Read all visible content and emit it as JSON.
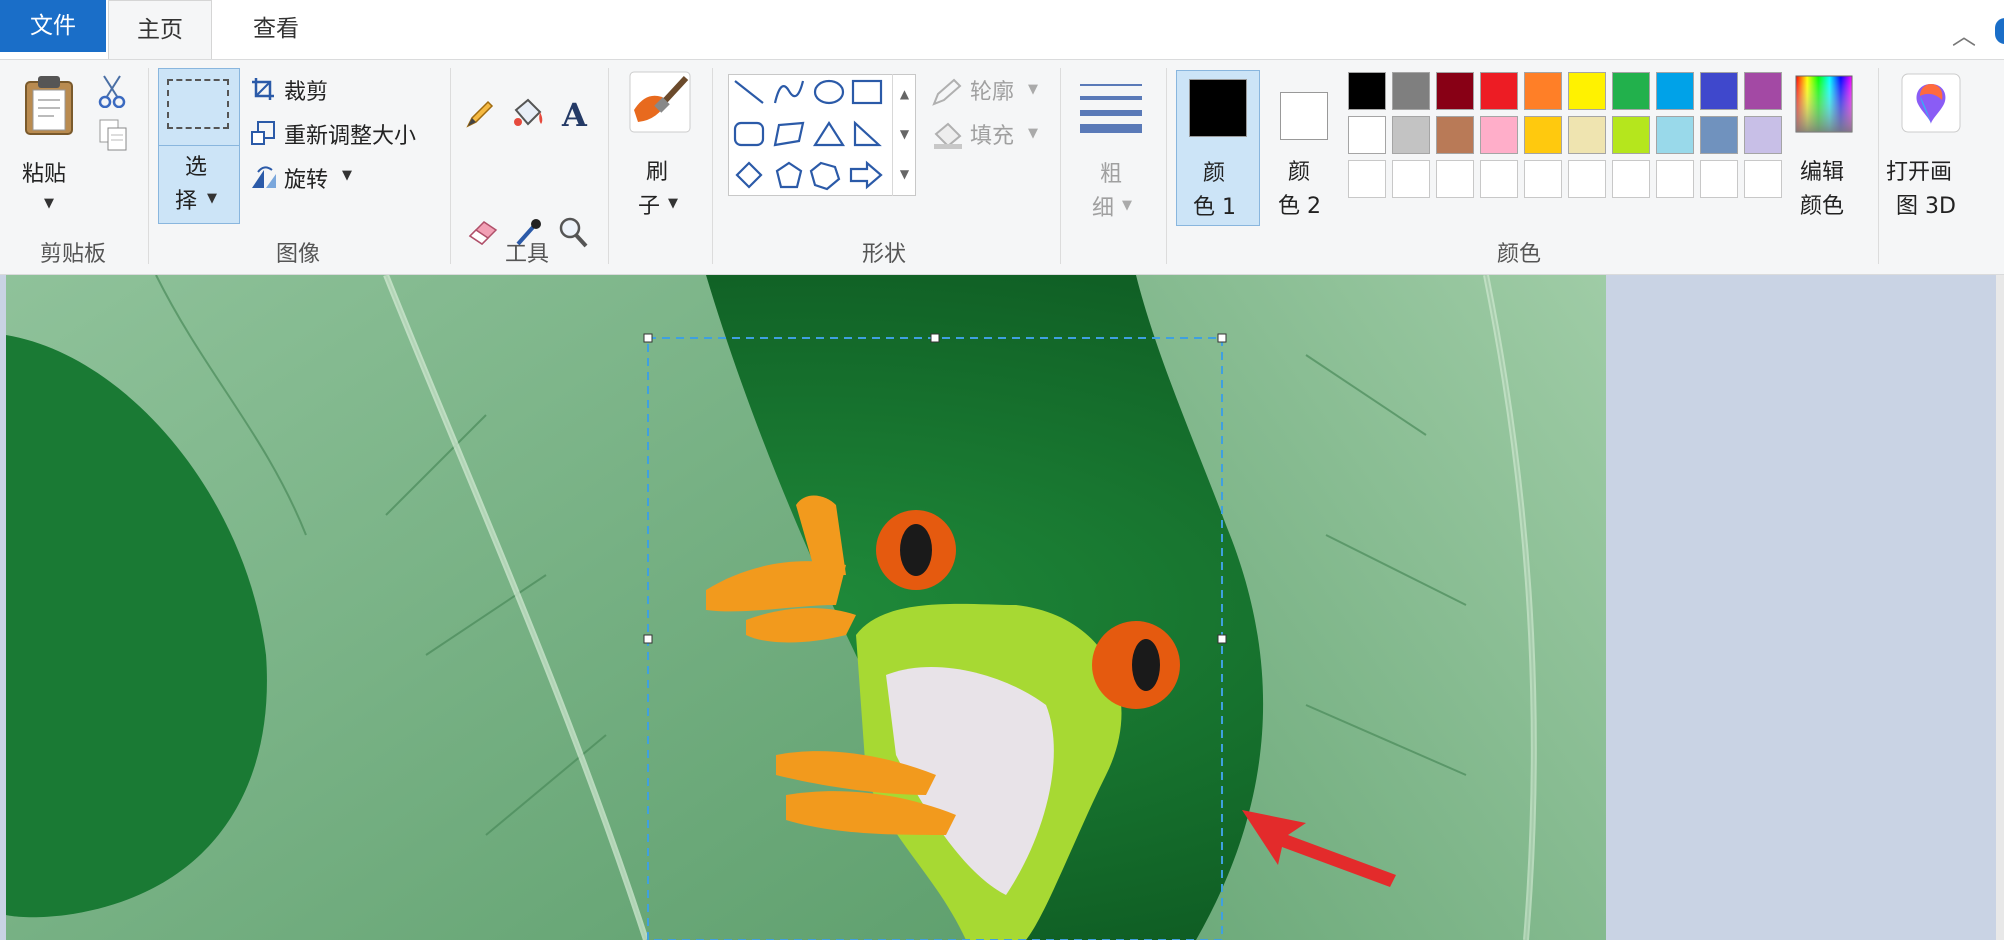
{
  "tabs": [
    {
      "label": "文件"
    },
    {
      "label": "主页"
    },
    {
      "label": "查看"
    }
  ],
  "groups": {
    "clipboard": {
      "label": "剪贴板",
      "paste": "粘贴"
    },
    "image": {
      "label": "图像",
      "select_line1": "选",
      "select_line2": "择",
      "crop": "裁剪",
      "resize": "重新调整大小",
      "rotate": "旋转"
    },
    "tools": {
      "label": "工具"
    },
    "brushes": {
      "line1": "刷",
      "line2": "子"
    },
    "shapes": {
      "label": "形状",
      "outline": "轮廓",
      "fill": "填充"
    },
    "size": {
      "line1": "粗",
      "line2": "细"
    },
    "colors": {
      "label": "颜色",
      "color1_line1": "颜",
      "color1_line2": "色 1",
      "color2_line1": "颜",
      "color2_line2": "色 2",
      "edit_line1": "编辑",
      "edit_line2": "颜色",
      "color1_value": "#000000",
      "color2_value": "#ffffff",
      "palette": [
        "#000000",
        "#7f7f7f",
        "#880015",
        "#ed1c24",
        "#ff7f27",
        "#fff200",
        "#22b14c",
        "#00a2e8",
        "#3f48cc",
        "#a349a4",
        "#ffffff",
        "#c3c3c3",
        "#b97a57",
        "#ffaec9",
        "#ffc90e",
        "#efe4b0",
        "#b5e61d",
        "#99d9ea",
        "#7092be",
        "#c8bfe7",
        "#ffffff",
        "#ffffff",
        "#ffffff",
        "#ffffff",
        "#ffffff",
        "#ffffff",
        "#ffffff",
        "#ffffff",
        "#ffffff",
        "#ffffff"
      ]
    },
    "paint3d": {
      "line1": "打开画",
      "line2": "图 3D"
    }
  },
  "accent_color": "#1a6ec8"
}
